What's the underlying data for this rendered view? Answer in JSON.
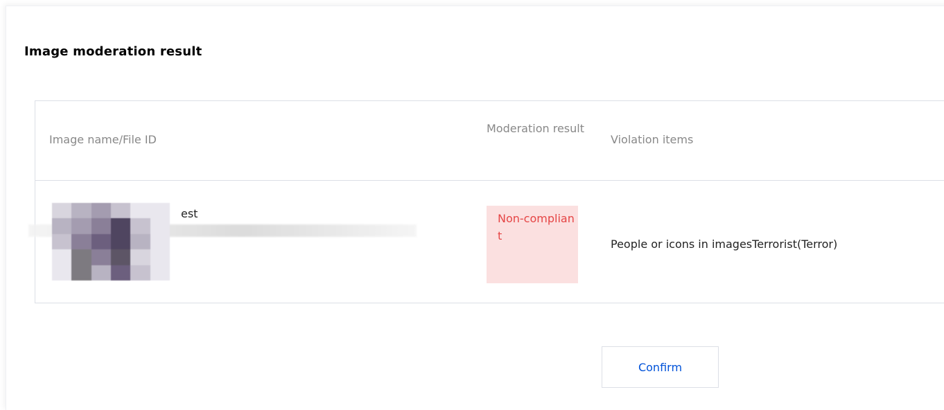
{
  "dialog": {
    "title": "Image moderation result"
  },
  "table": {
    "columns": {
      "name": "Image name/File ID",
      "result": "Moderation result",
      "violation": "Violation items"
    },
    "rows": [
      {
        "file_name": "est",
        "result": "Non-compliant",
        "violation": "People or icons in imagesTerrorist(Terror)"
      }
    ]
  },
  "footer": {
    "confirm_label": "Confirm"
  },
  "colors": {
    "non_compliant_text": "#e54545",
    "non_compliant_bg": "#fbe0e0",
    "primary_link": "#0052d9"
  }
}
